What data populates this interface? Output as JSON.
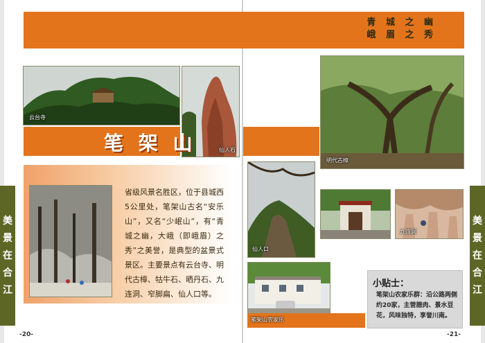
{
  "header": {
    "tagline_line1": "青 城 之 幽",
    "tagline_line2": "峨 眉 之 秀"
  },
  "title": "笔 架 山",
  "side_tab": [
    "美",
    "景",
    "在",
    "合",
    "江"
  ],
  "photos": {
    "yuntai_temple": "云台寺",
    "xianren_stone": "仙人石",
    "ming_camphor": "明代古樟",
    "xianren_entrance": "仙人口",
    "jiulian_cave": "九连洞",
    "farm_stay": "笔架山农家乐"
  },
  "description": "省级风景名胜区，位于县城西5公里处，笔架山古名“安乐山”，又名“少岷山”，有“青城之幽，大峨（即峨眉）之秀”之美誉，是典型的盆景式景区。主要景点有云台寺、明代古樟、牯牛石、晒丹石、九连洞、窄脚扁、仙人口等。",
  "tips": {
    "title": "小贴士：",
    "body": "笔架山农家乐群：沿公路两侧约20家，主营腊肉、景水豆花，风味独特，享誉川南。"
  },
  "page_numbers": {
    "left": "-20-",
    "right": "-21-"
  },
  "colors": {
    "accent_orange": "#e3741c",
    "olive_green": "#5e6625"
  }
}
